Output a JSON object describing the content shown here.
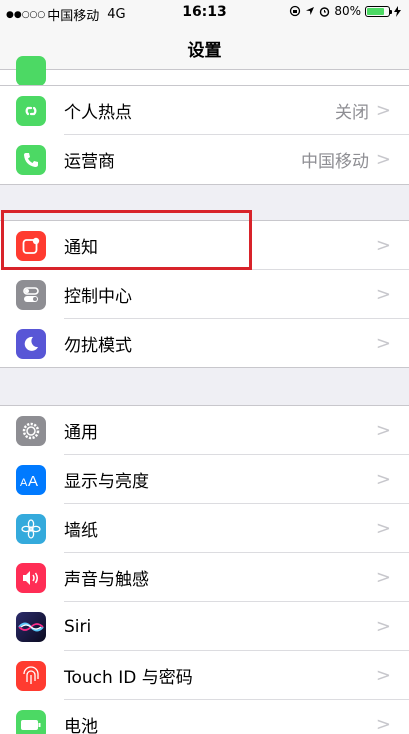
{
  "status_bar": {
    "signal_dots": "●●○○○",
    "carrier": "中国移动",
    "network": "4G",
    "time": "16:13",
    "battery_pct": "80%",
    "battery_level": 0.8
  },
  "nav": {
    "title": "设置"
  },
  "groups": [
    {
      "rows": [
        {
          "name": "hotspot",
          "label": "个人热点",
          "value": "关闭",
          "icon": "hotspot-icon",
          "color": "#4cd964"
        },
        {
          "name": "carrier",
          "label": "运营商",
          "value": "中国移动",
          "icon": "phone-icon",
          "color": "#4cd964"
        }
      ]
    },
    {
      "rows": [
        {
          "name": "notifications",
          "label": "通知",
          "value": "",
          "icon": "notification-icon",
          "color": "#ff3b30"
        },
        {
          "name": "control-center",
          "label": "控制中心",
          "value": "",
          "icon": "toggle-icon",
          "color": "#8e8e93"
        },
        {
          "name": "do-not-disturb",
          "label": "勿扰模式",
          "value": "",
          "icon": "moon-icon",
          "color": "#5856d6"
        }
      ]
    },
    {
      "rows": [
        {
          "name": "general",
          "label": "通用",
          "value": "",
          "icon": "gear-icon",
          "color": "#8e8e93"
        },
        {
          "name": "display",
          "label": "显示与亮度",
          "value": "",
          "icon": "text-size-icon",
          "color": "#007aff"
        },
        {
          "name": "wallpaper",
          "label": "墙纸",
          "value": "",
          "icon": "flower-icon",
          "color": "#34aadc"
        },
        {
          "name": "sounds",
          "label": "声音与触感",
          "value": "",
          "icon": "speaker-icon",
          "color": "#ff2d55"
        },
        {
          "name": "siri",
          "label": "Siri",
          "value": "",
          "icon": "siri-icon",
          "color": "#1c1c3a"
        },
        {
          "name": "touch-id",
          "label": "Touch ID 与密码",
          "value": "",
          "icon": "fingerprint-icon",
          "color": "#ff3b30"
        },
        {
          "name": "battery",
          "label": "电池",
          "value": "",
          "icon": "battery-icon",
          "color": "#4cd964"
        }
      ]
    }
  ]
}
